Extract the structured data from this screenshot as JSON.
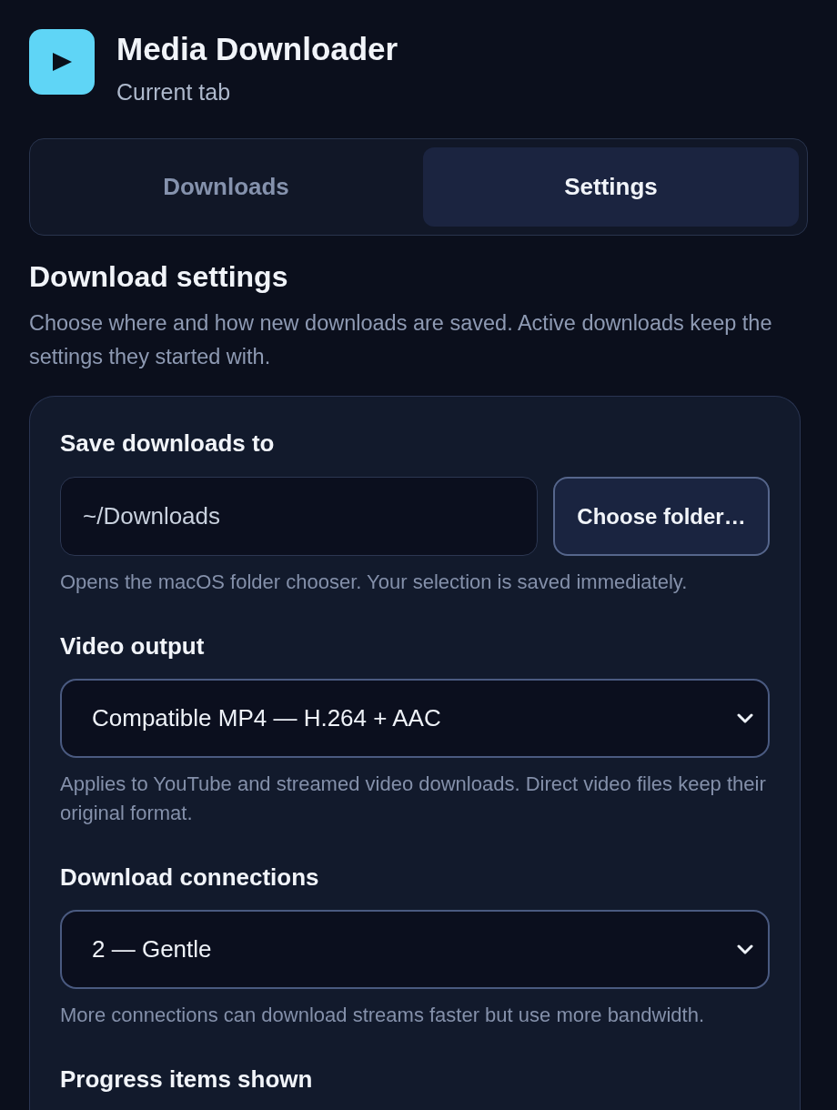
{
  "app": {
    "title": "Media Downloader",
    "subtitle": "Current tab"
  },
  "tabs": [
    {
      "label": "Downloads",
      "selected": false
    },
    {
      "label": "Settings",
      "selected": true
    }
  ],
  "section": {
    "heading": "Download settings",
    "description": "Choose where and how new downloads are saved. Active downloads keep the settings they started with."
  },
  "settings": [
    {
      "kind": "folder",
      "label": "Save downloads to",
      "value": "~/Downloads",
      "button": "Choose folder…",
      "hint": "Opens the macOS folder chooser. Your selection is saved immediately."
    },
    {
      "kind": "select",
      "label": "Video output",
      "value": "Compatible MP4 — H.264 + AAC",
      "hint": "Applies to YouTube and streamed video downloads. Direct video files keep their original format."
    },
    {
      "kind": "select",
      "label": "Download connections",
      "value": "2 — Gentle",
      "hint": "More connections can download streams faster but use more bandwidth."
    },
    {
      "kind": "label",
      "label": "Progress items shown"
    }
  ]
}
